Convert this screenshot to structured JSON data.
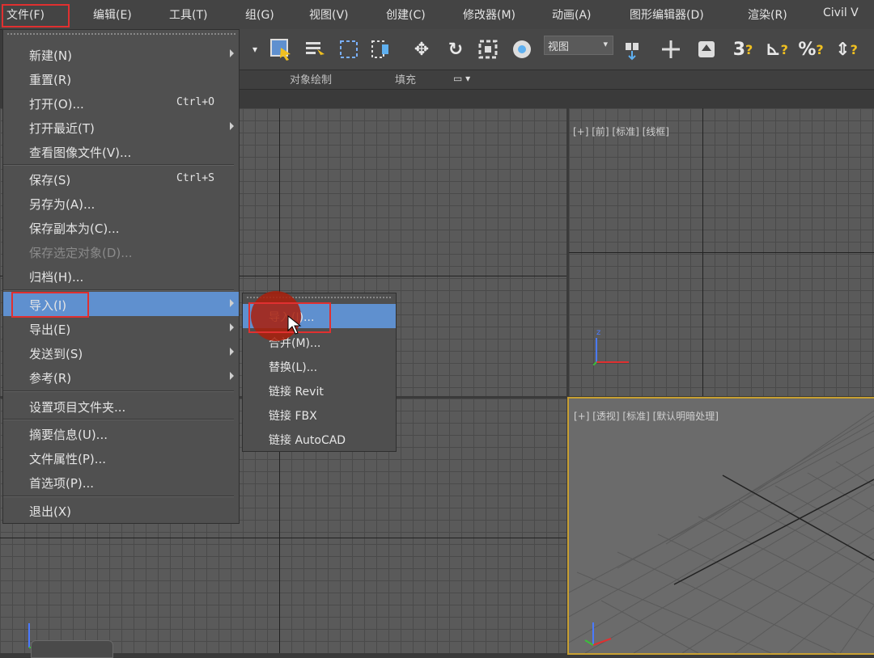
{
  "menubar": {
    "items": [
      "文件(F)",
      "编辑(E)",
      "工具(T)",
      "组(G)",
      "视图(V)",
      "创建(C)",
      "修改器(M)",
      "动画(A)",
      "图形编辑器(D)",
      "渲染(R)",
      "Civil V"
    ]
  },
  "toolbar": {
    "view_dropdown": "视图"
  },
  "ribbon": {
    "object_paint": "对象绘制",
    "populate": "填充"
  },
  "viewports": {
    "front_label": "[+] [前] [标准] [线框]",
    "perspective_label": "[+] [透视] [标准] [默认明暗处理]",
    "axis_z": "z"
  },
  "file_menu": {
    "items": [
      {
        "label": "新建(N)",
        "has_submenu": true
      },
      {
        "label": "重置(R)"
      },
      {
        "label": "打开(O)...",
        "shortcut": "Ctrl+O"
      },
      {
        "label": "打开最近(T)",
        "has_submenu": true
      },
      {
        "label": "查看图像文件(V)..."
      },
      {
        "label": "保存(S)",
        "shortcut": "Ctrl+S"
      },
      {
        "label": "另存为(A)..."
      },
      {
        "label": "保存副本为(C)..."
      },
      {
        "label": "保存选定对象(D)...",
        "disabled": true
      },
      {
        "label": "归档(H)..."
      },
      {
        "label": "导入(I)",
        "has_submenu": true,
        "active": true
      },
      {
        "label": "导出(E)",
        "has_submenu": true
      },
      {
        "label": "发送到(S)",
        "has_submenu": true
      },
      {
        "label": "参考(R)",
        "has_submenu": true
      },
      {
        "label": "设置项目文件夹..."
      },
      {
        "label": "摘要信息(U)..."
      },
      {
        "label": "文件属性(P)..."
      },
      {
        "label": "首选项(P)..."
      },
      {
        "label": "退出(X)"
      }
    ]
  },
  "import_submenu": {
    "items": [
      {
        "label": "导入(I)...",
        "active": true
      },
      {
        "label": "合并(M)..."
      },
      {
        "label": "替换(L)..."
      },
      {
        "label": "链接 Revit"
      },
      {
        "label": "链接 FBX"
      },
      {
        "label": "链接 AutoCAD"
      }
    ]
  },
  "colors": {
    "highlight": "#5f90cf",
    "annotation_red": "#e03030",
    "active_viewport_border": "#c8a032"
  }
}
